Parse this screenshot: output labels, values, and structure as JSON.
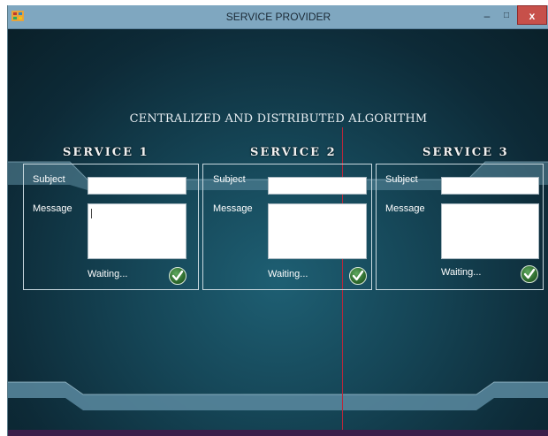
{
  "window": {
    "title": "SERVICE PROVIDER",
    "controls": {
      "minimize": "–",
      "maximize": "□",
      "close": "x"
    }
  },
  "main": {
    "heading": "CENTRALIZED AND DISTRIBUTED ALGORITHM"
  },
  "services": [
    {
      "title": "SERVICE 1",
      "subject_label": "Subject",
      "message_label": "Message",
      "subject_value": "",
      "message_value": "",
      "status": "Waiting..."
    },
    {
      "title": "SERVICE 2",
      "subject_label": "Subject",
      "message_label": "Message",
      "subject_value": "",
      "message_value": "",
      "status": "Waiting..."
    },
    {
      "title": "SERVICE 3",
      "subject_label": "Subject",
      "message_label": "Message",
      "subject_value": "",
      "message_value": "",
      "status": "Waiting..."
    }
  ],
  "icons": {
    "app": "app-icon",
    "status": "checkmark-icon"
  },
  "colors": {
    "titlebar": "#7fa7c0",
    "close_button": "#c7504a",
    "background": "#154556",
    "accent_line": "#b6283b",
    "check": "#2e6b2e"
  }
}
